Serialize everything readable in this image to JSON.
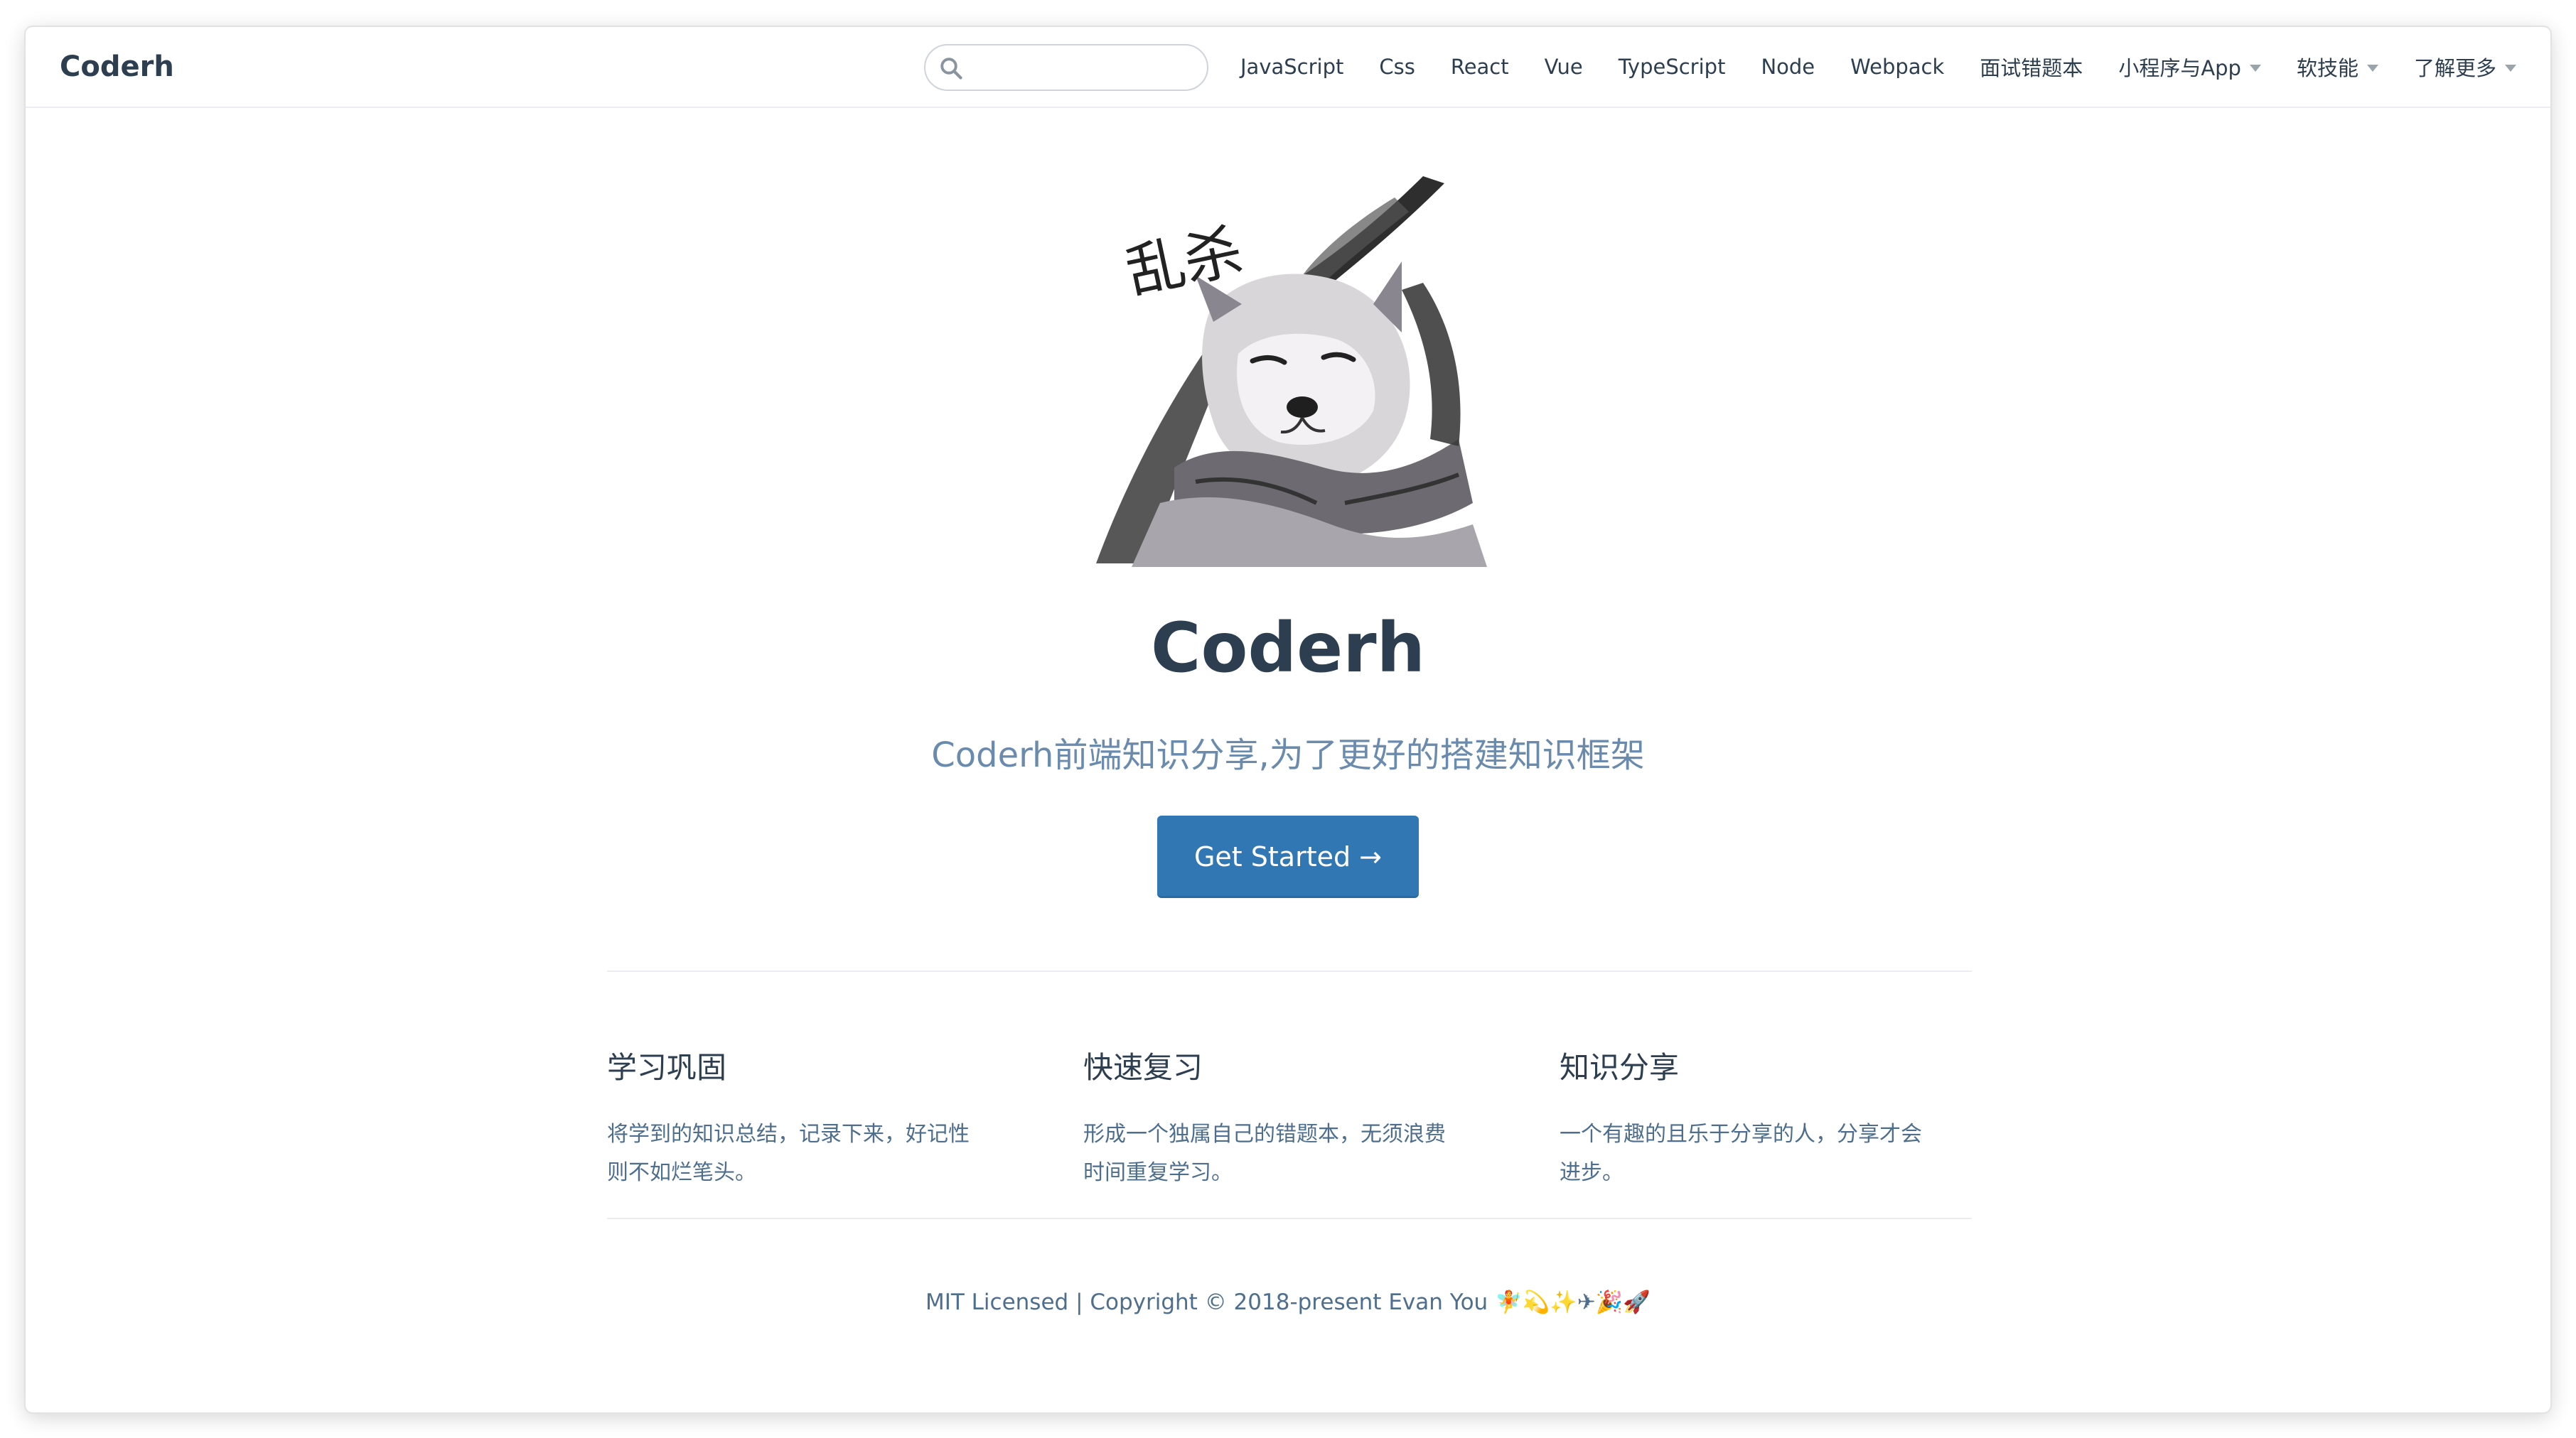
{
  "site": {
    "name": "Coderh"
  },
  "search": {
    "value": "",
    "placeholder": ""
  },
  "nav": {
    "items": [
      {
        "label": "JavaScript"
      },
      {
        "label": "Css"
      },
      {
        "label": "React"
      },
      {
        "label": "Vue"
      },
      {
        "label": "TypeScript"
      },
      {
        "label": "Node"
      },
      {
        "label": "Webpack"
      },
      {
        "label": "面试错题本"
      },
      {
        "label": "小程序与App"
      },
      {
        "label": "软技能"
      },
      {
        "label": "了解更多"
      }
    ]
  },
  "hero": {
    "image_caption": "乱杀",
    "title": "Coderh",
    "description": "Coderh前端知识分享,为了更好的搭建知识框架",
    "action_label": "Get Started →"
  },
  "features": [
    {
      "title": "学习巩固",
      "line1": "将学到的知识总结，记录下来，好记性",
      "line2": "则不如烂笔头。"
    },
    {
      "title": "快速复习",
      "line1": "形成一个独属自己的错题本，无须浪费",
      "line2": "时间重复学习。"
    },
    {
      "title": "知识分享",
      "line1": "一个有趣的且乐于分享的人，分享才会",
      "line2": "进步。"
    }
  ],
  "footer": {
    "text": "MIT Licensed | Copyright © 2018-present Evan You 🧚💫✨✈🎉🚀"
  },
  "colors": {
    "accent": "#3077b4",
    "text": "#2c3e50",
    "muted": "#6a8bad"
  }
}
